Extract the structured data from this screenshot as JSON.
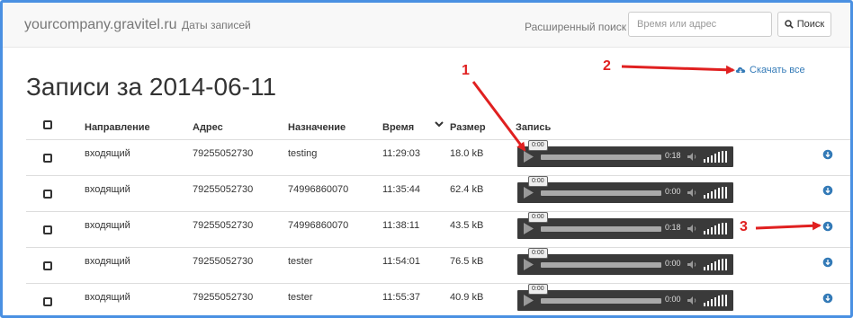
{
  "header": {
    "brand": "yourcompany.gravitel.ru",
    "nav_link": "Даты записей",
    "advanced_search": "Расширенный поиск",
    "search_placeholder": "Время или адрес",
    "search_button": "Поиск"
  },
  "page": {
    "title": "Записи за 2014-06-11",
    "download_all": "Скачать все"
  },
  "table": {
    "columns": [
      "Направление",
      "Адрес",
      "Назначение",
      "Время",
      "Размер",
      "Запись"
    ],
    "rows": [
      {
        "direction": "входящий",
        "address": "79255052730",
        "destination": "testing",
        "time": "11:29:03",
        "size": "18.0 kB",
        "player_float": "0:00",
        "player_time": "0:18"
      },
      {
        "direction": "входящий",
        "address": "79255052730",
        "destination": "74996860070",
        "time": "11:35:44",
        "size": "62.4 kB",
        "player_float": "0:00",
        "player_time": "0:00"
      },
      {
        "direction": "входящий",
        "address": "79255052730",
        "destination": "74996860070",
        "time": "11:38:11",
        "size": "43.5 kB",
        "player_float": "0:00",
        "player_time": "0:18"
      },
      {
        "direction": "входящий",
        "address": "79255052730",
        "destination": "tester",
        "time": "11:54:01",
        "size": "76.5 kB",
        "player_float": "0:00",
        "player_time": "0:00"
      },
      {
        "direction": "входящий",
        "address": "79255052730",
        "destination": "tester",
        "time": "11:55:37",
        "size": "40.9 kB",
        "player_float": "0:00",
        "player_time": "0:00"
      }
    ]
  },
  "annotations": [
    "1",
    "2",
    "3"
  ],
  "colors": {
    "accent": "#337ab7",
    "annotation": "#e02020",
    "frame": "#4a90e2",
    "player": "#3a3a3a"
  }
}
